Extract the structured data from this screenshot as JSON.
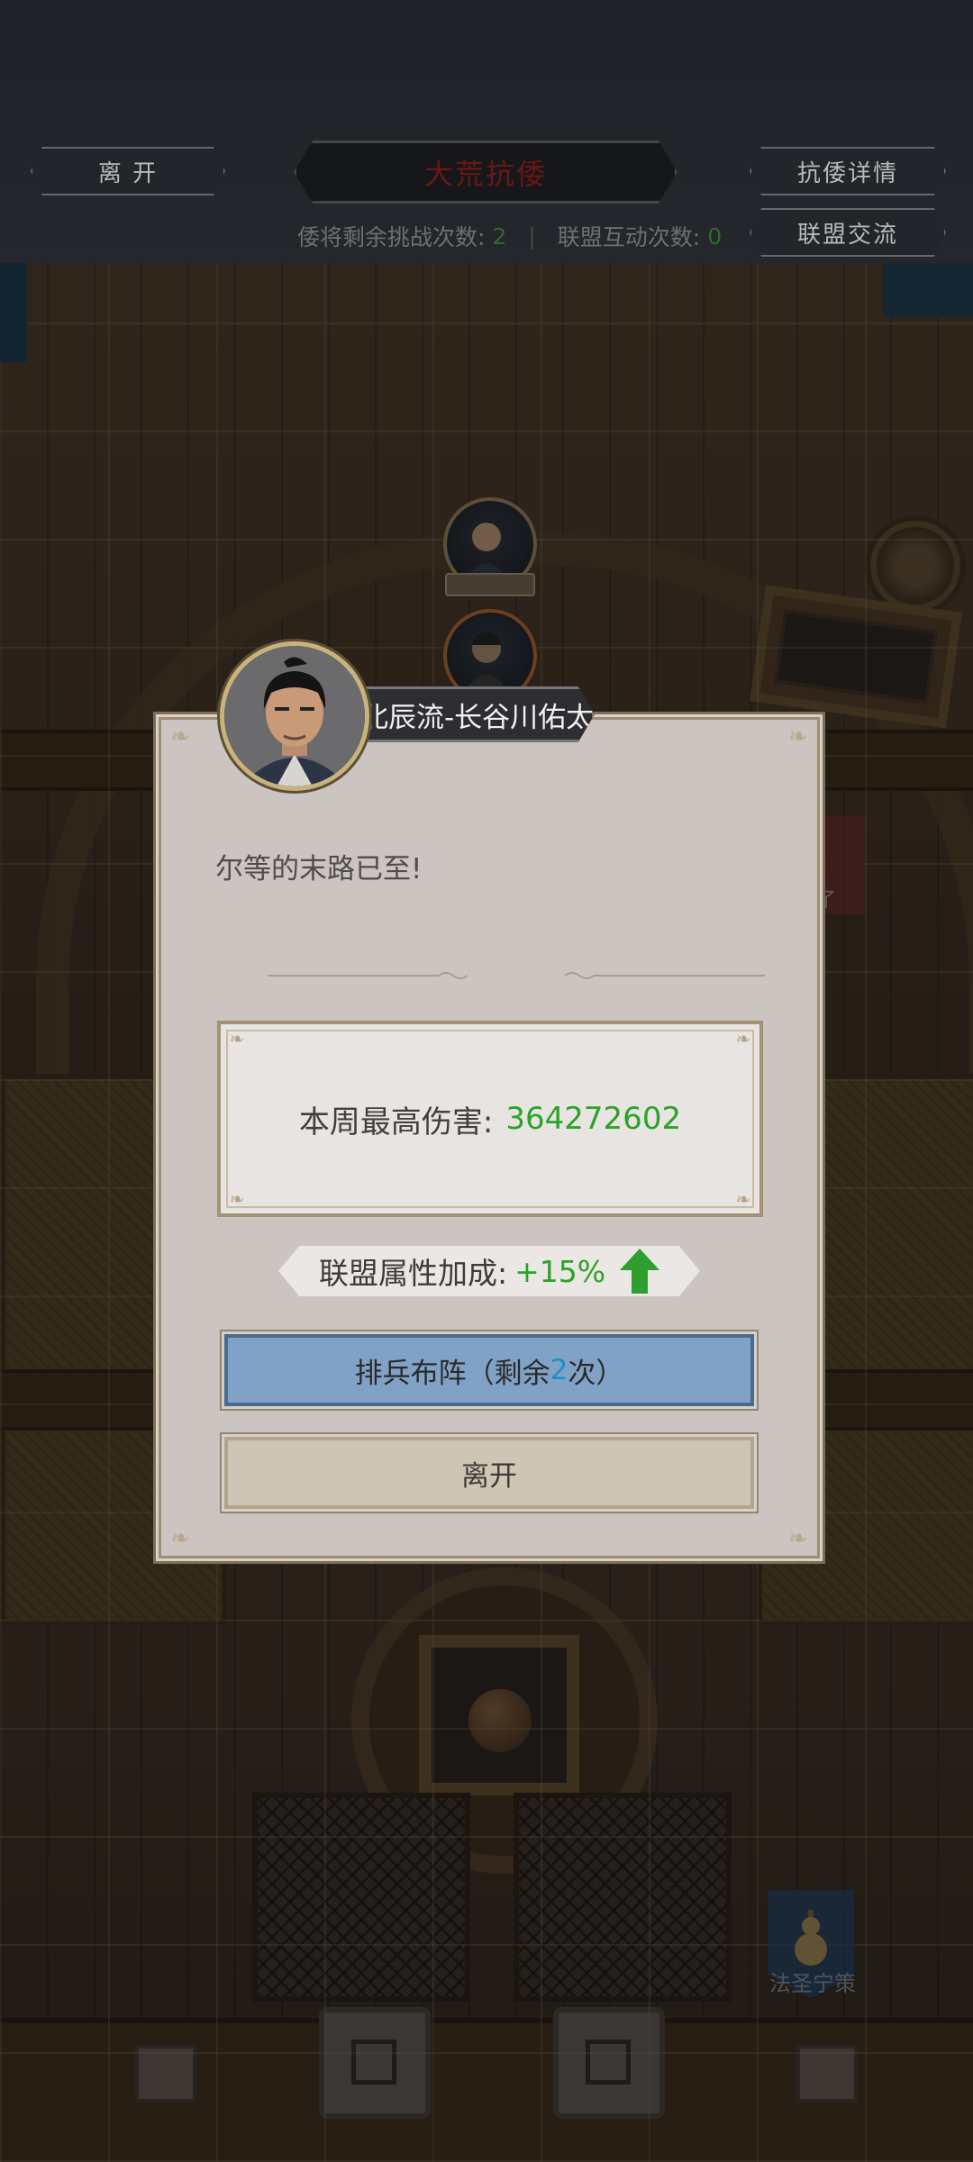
{
  "header": {
    "leave_label": "离 开",
    "title": "大荒抗倭",
    "detail_label": "抗倭详情",
    "exchange_label": "联盟交流",
    "challenge_label": "倭将剩余挑战次数:",
    "challenge_count": "2",
    "interact_label": "联盟互动次数:",
    "interact_count": "0"
  },
  "board": {
    "flag_label": "法圣宁策",
    "banner_text": "了"
  },
  "dialog": {
    "speaker_name": "北辰流-长谷川佑太",
    "quote": "尔等的末路已至!",
    "damage_label": "本周最高伤害:",
    "damage_value": "364272602",
    "bonus_label": "联盟属性加成:",
    "bonus_value": "+15%",
    "deploy_prefix": "排兵布阵（剩余",
    "deploy_count": "2",
    "deploy_suffix": "次）",
    "leave_label": "离开"
  },
  "colors": {
    "accent_green": "#2aa328",
    "deploy_blue": "#7fa2c6",
    "title_red": "#6b1714"
  },
  "icons": {
    "bonus_arrow": "arrow-up-icon",
    "portrait": "samurai-portrait-icon"
  }
}
